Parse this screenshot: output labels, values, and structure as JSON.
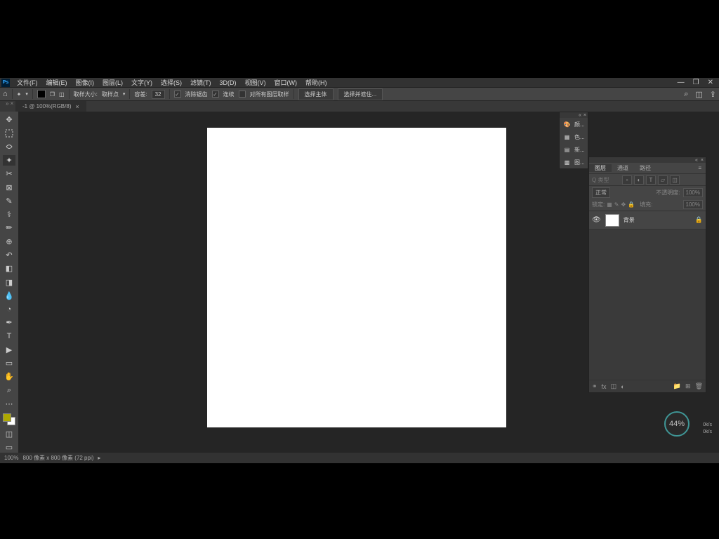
{
  "menubar": {
    "items": [
      "文件(F)",
      "编辑(E)",
      "图像(I)",
      "图层(L)",
      "文字(Y)",
      "选择(S)",
      "滤镜(T)",
      "3D(D)",
      "视图(V)",
      "窗口(W)",
      "帮助(H)"
    ]
  },
  "winctrl": {
    "min": "—",
    "max": "❐",
    "close": "✕"
  },
  "optbar": {
    "sample_label": "取样大小:",
    "sample_value": "取样点",
    "tol_label": "容差:",
    "tol_value": "32",
    "chk1": "消除锯齿",
    "chk2": "连续",
    "chk3": "对所有图层取样",
    "btn1": "选择主体",
    "btn2": "选择并遮住..."
  },
  "tab": {
    "title": "-1 @ 100%(RGB/8)"
  },
  "collapsed": {
    "items": [
      {
        "icon": "palette",
        "label": "颜..."
      },
      {
        "icon": "swatches",
        "label": "色..."
      },
      {
        "icon": "gradient",
        "label": "新..."
      },
      {
        "icon": "pattern",
        "label": "图..."
      }
    ]
  },
  "layers_panel": {
    "tabs": [
      "图层",
      "通道",
      "路径"
    ],
    "search_ph": "Q 类型",
    "blend_mode": "正常",
    "opacity_label": "不透明度:",
    "opacity_val": "100%",
    "lock_label": "锁定:",
    "fill_label": "填充:",
    "fill_val": "100%",
    "layer_name": "背景"
  },
  "status": {
    "zoom": "100%",
    "doc": "800 像素 x 800 像素 (72 ppi)"
  },
  "cpu": {
    "pct": "44%",
    "l1": "0k/s",
    "l2": "0k/s"
  }
}
